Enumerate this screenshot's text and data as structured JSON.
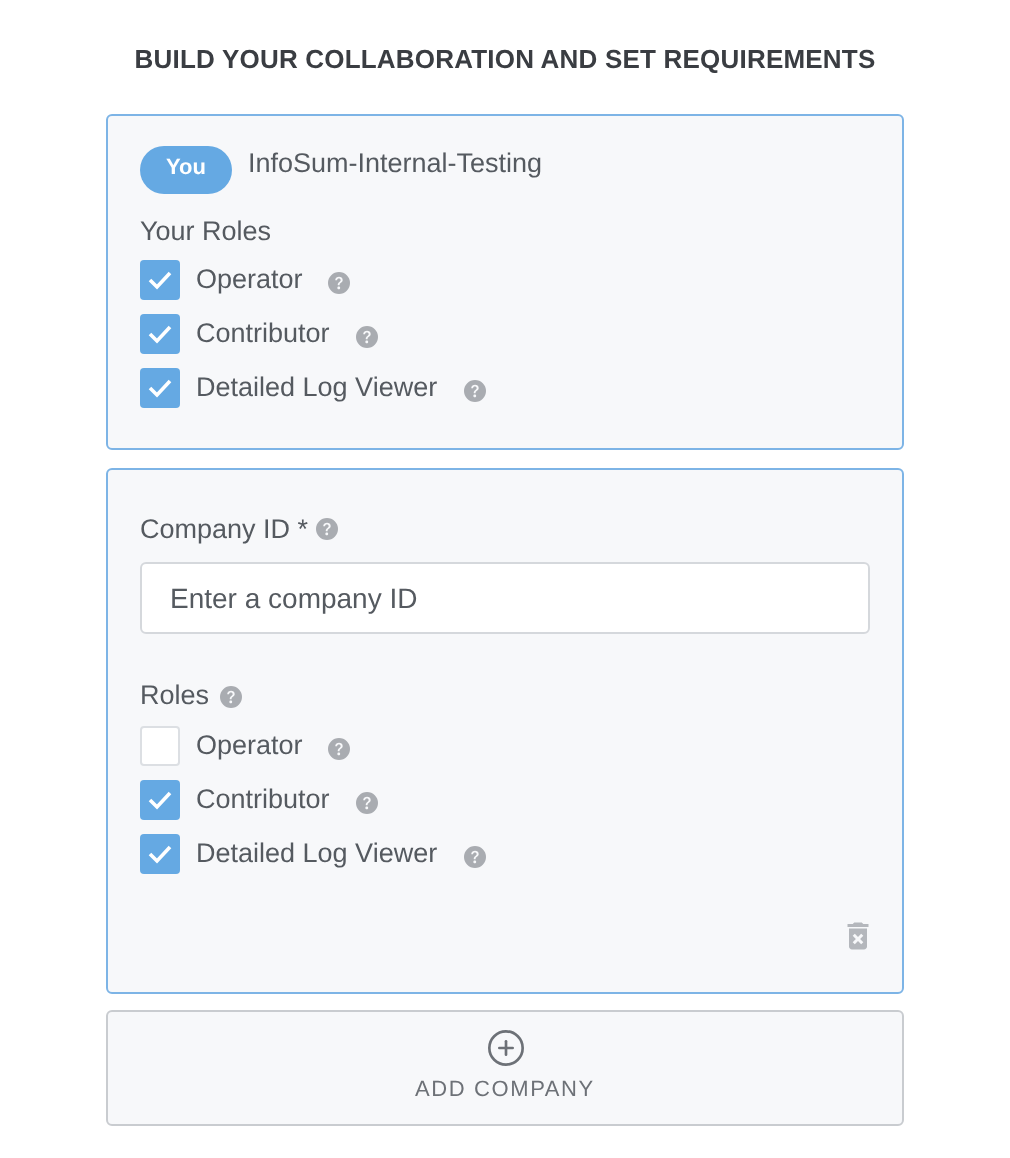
{
  "heading": "BUILD YOUR COLLABORATION AND SET REQUIREMENTS",
  "own_company": {
    "badge": "You",
    "name": "InfoSum-Internal-Testing",
    "roles_label": "Your Roles",
    "roles": [
      {
        "label": "Operator",
        "checked": true
      },
      {
        "label": "Contributor",
        "checked": true
      },
      {
        "label": "Detailed Log Viewer",
        "checked": true
      }
    ]
  },
  "companies": [
    {
      "id_label": "Company ID *",
      "placeholder": "Enter a company ID",
      "roles_label": "Roles",
      "roles": [
        {
          "label": "Operator",
          "checked": false
        },
        {
          "label": "Contributor",
          "checked": true
        },
        {
          "label": "Detailed Log Viewer",
          "checked": true
        }
      ]
    }
  ],
  "add_button": "ADD COMPANY"
}
